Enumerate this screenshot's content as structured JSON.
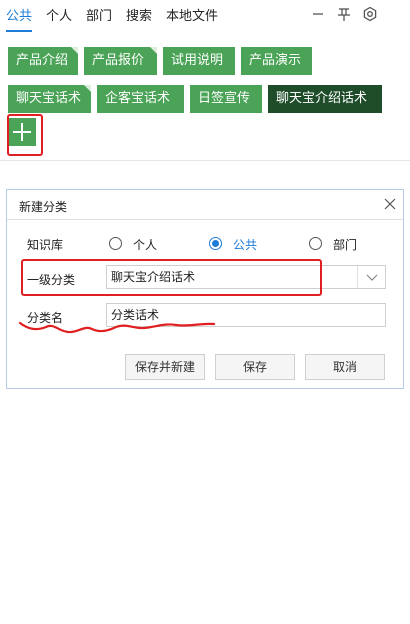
{
  "top_tabs": [
    {
      "label": "公共",
      "active": true
    },
    {
      "label": "个人"
    },
    {
      "label": "部门"
    },
    {
      "label": "搜索"
    },
    {
      "label": "本地文件"
    }
  ],
  "tool_icons": [
    "minimize-icon",
    "pin-icon",
    "settings-icon"
  ],
  "tags": [
    {
      "label": "产品介绍"
    },
    {
      "label": "产品报价"
    },
    {
      "label": "试用说明"
    },
    {
      "label": "产品演示"
    },
    {
      "label": "聊天宝话术"
    },
    {
      "label": "企客宝话术"
    },
    {
      "label": "日签宣传"
    },
    {
      "label": "聊天宝介绍话术"
    }
  ],
  "dialog": {
    "title": "新建分类",
    "knowledge_base_label": "知识库",
    "options": [
      {
        "label": "个人",
        "selected": false
      },
      {
        "label": "公共",
        "selected": true
      },
      {
        "label": "部门",
        "selected": false
      }
    ],
    "level1_label": "一级分类",
    "level1_value": "聊天宝介绍话术",
    "name_label": "分类名",
    "name_value": "分类话术",
    "buttons": {
      "save_new": "保存并新建",
      "save": "保存",
      "cancel": "取消"
    }
  },
  "colors": {
    "accent": "#1e7bd8",
    "tag_green": "#4aa356",
    "tag_active": "#1f4d2a",
    "annotation_red": "#e02020"
  }
}
